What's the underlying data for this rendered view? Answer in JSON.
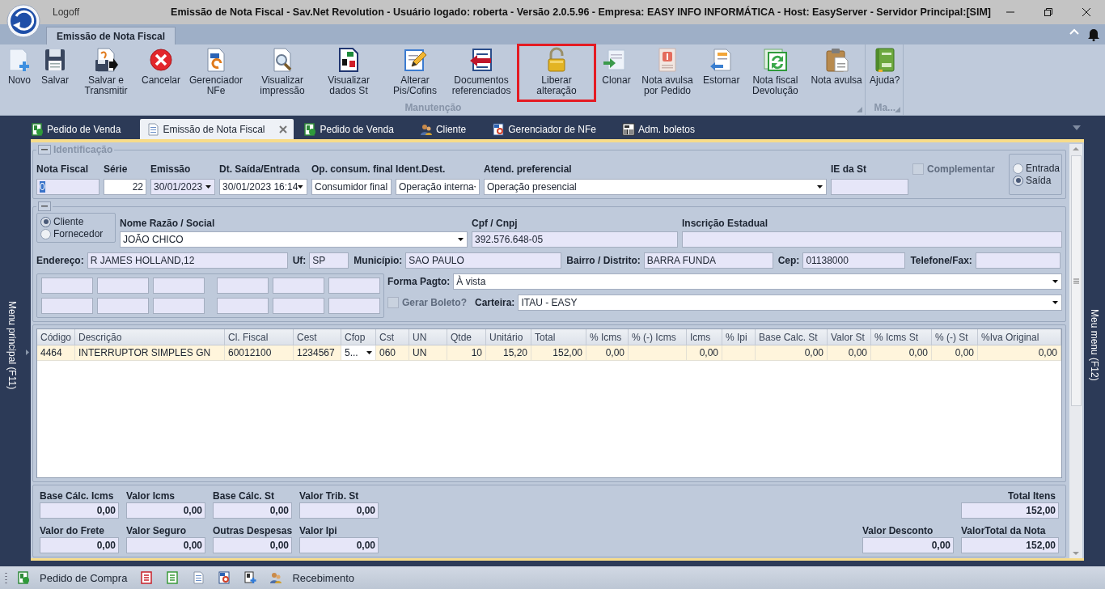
{
  "window": {
    "logoff": "Logoff",
    "title": "Emissão de Nota Fiscal - Sav.Net Revolution - Usuário logado: roberta - Versão 2.0.5.96 - Empresa: EASY INFO INFORMÁTICA - Host: EasyServer - Servidor Principal:[SIM]"
  },
  "ribbon": {
    "tabs": [
      {
        "label": "Emissão de Nota Fiscal",
        "selected": true
      }
    ],
    "groups": [
      {
        "label": "Manutenção",
        "buttons": [
          {
            "label": "Novo",
            "kind": "new",
            "highlighted": false
          },
          {
            "label": "Salvar",
            "kind": "save",
            "highlighted": false
          },
          {
            "label": "Salvar e Transmitir",
            "kind": "save_send",
            "highlighted": false
          },
          {
            "label": "Cancelar",
            "kind": "cancel",
            "highlighted": false
          },
          {
            "label": "Gerenciador NFe",
            "kind": "nfe",
            "highlighted": false
          },
          {
            "label": "Visualizar impressão",
            "kind": "preview",
            "highlighted": false
          },
          {
            "label": "Visualizar dados St",
            "kind": "percent",
            "highlighted": false
          },
          {
            "label": "Alterar Pis/Cofins",
            "kind": "edit",
            "highlighted": false
          },
          {
            "label": "Documentos referenciados",
            "kind": "referenced",
            "highlighted": false
          },
          {
            "label": "Liberar alteração",
            "kind": "unlock",
            "highlighted": true
          },
          {
            "label": "Clonar",
            "kind": "clone",
            "highlighted": false
          },
          {
            "label": "Nota avulsa por Pedido",
            "kind": "dollar",
            "highlighted": false
          },
          {
            "label": "Estornar",
            "kind": "reverse",
            "highlighted": false
          },
          {
            "label": "Nota fiscal Devolução",
            "kind": "refresh",
            "highlighted": false
          },
          {
            "label": "Nota avulsa",
            "kind": "clipboard",
            "highlighted": false
          }
        ]
      },
      {
        "label": "Ma...",
        "buttons": [
          {
            "label": "Ajuda?",
            "kind": "book",
            "highlighted": false
          }
        ]
      }
    ]
  },
  "side_menus": {
    "left": "Menu principal (F11)",
    "right": "Meu menu (F12)"
  },
  "doc_tabs": [
    {
      "label": "Pedido de Venda",
      "kind": "order",
      "selected": false
    },
    {
      "label": "Emissão de Nota Fiscal",
      "kind": "doc",
      "selected": true
    },
    {
      "label": "Pedido de Venda",
      "kind": "order",
      "selected": false
    },
    {
      "label": "Cliente",
      "kind": "people",
      "selected": false
    },
    {
      "label": "Gerenciador de NFe",
      "kind": "nfe",
      "selected": false
    },
    {
      "label": "Adm. boletos",
      "kind": "barcode",
      "selected": false
    }
  ],
  "identificacao": {
    "title": "Identificação",
    "fields": [
      {
        "label": "Nota Fiscal",
        "value": "0",
        "kind": "text",
        "readonly": true,
        "text_selected": true
      },
      {
        "label": "Série",
        "value": "22",
        "kind": "number",
        "readonly": false
      },
      {
        "label": "Emissão",
        "value": "30/01/2023",
        "kind": "combo",
        "readonly": true
      },
      {
        "label": "Dt. Saída/Entrada",
        "value": "30/01/2023 16:14",
        "kind": "combo",
        "readonly": false
      },
      {
        "label": "Op. consum. final",
        "value": "Consumidor final",
        "kind": "combo",
        "readonly": false
      },
      {
        "label": "Ident.Dest.",
        "value": "Operação interna",
        "kind": "combo",
        "readonly": false
      },
      {
        "label": "Atend. preferencial",
        "value": "Operação presencial",
        "kind": "combo",
        "readonly": false
      },
      {
        "label": "IE da St",
        "kind": "text",
        "readonly": true
      }
    ],
    "complementar": {
      "label": "Complementar",
      "checked": false,
      "disabled": true
    },
    "direction": [
      {
        "label": "Entrada",
        "selected": false
      },
      {
        "label": "Saída",
        "selected": true
      }
    ]
  },
  "destinatario": {
    "party": [
      {
        "label": "Cliente",
        "selected": true
      },
      {
        "label": "Fornecedor",
        "selected": false
      }
    ],
    "top_fields": [
      {
        "label": "Nome Razão / Social",
        "value": "JOÃO CHICO",
        "kind": "combo",
        "readonly": false
      },
      {
        "label": "Cpf / Cnpj",
        "value": "392.576.648-05",
        "kind": "text",
        "readonly": true
      },
      {
        "label": "Inscrição Estadual",
        "kind": "text",
        "readonly": true
      }
    ],
    "address_fields": [
      {
        "label": "Endereço:",
        "value": "R JAMES HOLLAND,12",
        "kind": "text",
        "readonly": true
      },
      {
        "label": "Uf:",
        "value": "SP",
        "kind": "text",
        "readonly": true
      },
      {
        "label": "Município:",
        "value": "SAO PAULO",
        "kind": "text",
        "readonly": true
      },
      {
        "label": "Bairro / Distrito:",
        "value": "BARRA FUNDA",
        "kind": "text",
        "readonly": true
      },
      {
        "label": "Cep:",
        "value": "01138000",
        "kind": "text",
        "readonly": true
      },
      {
        "label": "Telefone/Fax:",
        "kind": "text",
        "readonly": true
      }
    ],
    "extra_fields": [
      {
        "readonly": true
      },
      {
        "readonly": true
      },
      {
        "readonly": true
      },
      {
        "readonly": true
      },
      {
        "readonly": true
      },
      {
        "readonly": true
      },
      {
        "readonly": true
      },
      {
        "readonly": true
      },
      {
        "readonly": true
      },
      {
        "readonly": true
      },
      {
        "readonly": true
      },
      {
        "readonly": true
      }
    ],
    "forma_pagto": {
      "label": "Forma Pagto:",
      "value": "À vista",
      "kind": "combo",
      "readonly": false
    },
    "gerar_boleto": {
      "label": "Gerar Boleto?",
      "checked": false,
      "disabled": true
    },
    "carteira": {
      "label": "Carteira:",
      "value": "ITAU - EASY",
      "kind": "combo",
      "readonly": false
    }
  },
  "items_table": {
    "columns": [
      {
        "label": "Código",
        "kind": "text"
      },
      {
        "label": "Descrição",
        "kind": "text"
      },
      {
        "label": "Cl. Fiscal",
        "kind": "text"
      },
      {
        "label": "Cest",
        "kind": "text"
      },
      {
        "label": "Cfop",
        "kind": "combo"
      },
      {
        "label": "Cst",
        "kind": "text"
      },
      {
        "label": "UN",
        "kind": "text"
      },
      {
        "label": "Qtde",
        "kind": "number"
      },
      {
        "label": "Unitário",
        "kind": "number"
      },
      {
        "label": "Total",
        "kind": "number"
      },
      {
        "label": "% Icms",
        "kind": "number"
      },
      {
        "label": "% (-) Icms",
        "kind": "number"
      },
      {
        "label": "Icms",
        "kind": "number"
      },
      {
        "label": "% Ipi",
        "kind": "number"
      },
      {
        "label": "Base Calc. St",
        "kind": "number"
      },
      {
        "label": "Valor St",
        "kind": "number"
      },
      {
        "label": "% Icms St",
        "kind": "number"
      },
      {
        "label": "% (-) St",
        "kind": "number"
      },
      {
        "label": "%Iva Original",
        "kind": "number"
      }
    ],
    "rows": [
      {
        "selected": true,
        "cells": [
          "4464",
          "INTERRUPTOR SIMPLES GN",
          "60012100",
          "1234567",
          "5...",
          "060",
          "UN",
          "10",
          "15,20",
          "152,00",
          "0,00",
          null,
          "0,00",
          null,
          "0,00",
          "0,00",
          "0,00",
          "0,00",
          "0,00"
        ]
      }
    ]
  },
  "totals": {
    "left": [
      {
        "label": "Base Cálc. Icms",
        "value": "0,00"
      },
      {
        "label": "Valor Icms",
        "value": "0,00"
      },
      {
        "label": "Base Cálc. St",
        "value": "0,00"
      },
      {
        "label": "Valor Trib. St",
        "value": "0,00"
      },
      {
        "label": "Valor do Frete",
        "value": "0,00"
      },
      {
        "label": "Valor Seguro",
        "value": "0,00"
      },
      {
        "label": "Outras Despesas",
        "value": "0,00"
      },
      {
        "label": "Valor Ipi",
        "value": "0,00"
      }
    ],
    "right": [
      {
        "label": "Total Itens",
        "value": "152,00"
      },
      {
        "label": "Valor Desconto",
        "value": "0,00"
      },
      {
        "label": "ValorTotal da Nota",
        "value": "152,00"
      }
    ]
  },
  "status_bar": [
    {
      "kind": "order",
      "label": "Pedido de Compra"
    },
    {
      "kind": "red_list"
    },
    {
      "kind": "green_list"
    },
    {
      "kind": "doc"
    },
    {
      "kind": "nfe"
    },
    {
      "kind": "order_add"
    },
    {
      "kind": "people",
      "label": "Recebimento"
    }
  ]
}
